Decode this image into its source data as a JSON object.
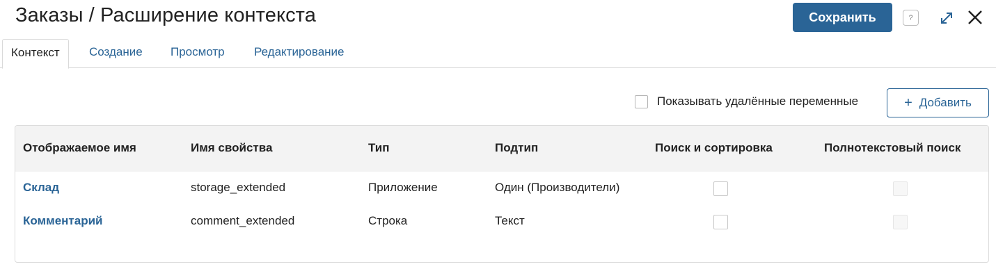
{
  "header": {
    "title": "Заказы / Расширение контекста",
    "save_label": "Сохранить",
    "help_glyph": "?"
  },
  "tabs": [
    {
      "label": "Контекст",
      "active": true
    },
    {
      "label": "Создание",
      "active": false
    },
    {
      "label": "Просмотр",
      "active": false
    },
    {
      "label": "Редактирование",
      "active": false
    }
  ],
  "toolbar": {
    "show_deleted_label": "Показывать удалённые переменные",
    "show_deleted_checked": false,
    "add_label": "Добавить",
    "add_icon": "plus-icon"
  },
  "table": {
    "columns": [
      "Отображаемое имя",
      "Имя свойства",
      "Тип",
      "Подтип",
      "Поиск и сортировка",
      "Полнотекстовый поиск"
    ],
    "rows": [
      {
        "display_name": "Склад",
        "property_name": "storage_extended",
        "type": "Приложение",
        "subtype": "Один (Производители)",
        "search_sort": false,
        "fulltext": false,
        "fulltext_disabled": true
      },
      {
        "display_name": "Комментарий",
        "property_name": "comment_extended",
        "type": "Строка",
        "subtype": "Текст",
        "search_sort": false,
        "fulltext": false,
        "fulltext_disabled": true
      }
    ]
  },
  "colors": {
    "accent": "#2a6496",
    "header_bg": "#f3f3f3",
    "border": "#dcdcdc"
  }
}
